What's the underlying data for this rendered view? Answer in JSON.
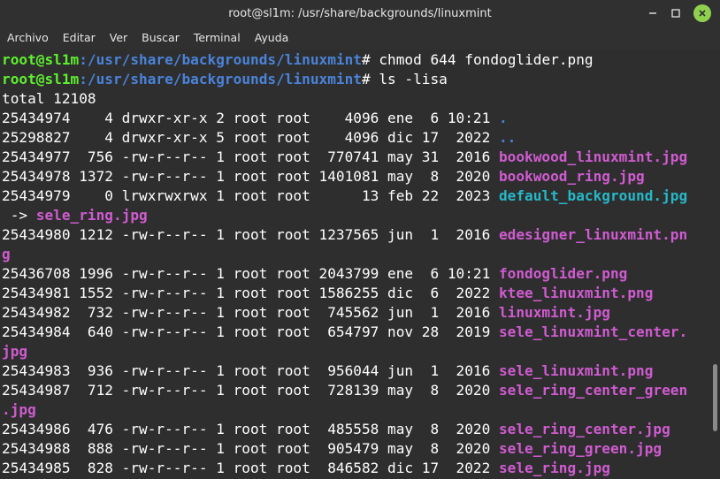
{
  "window": {
    "title": "root@sl1m: /usr/share/backgrounds/linuxmint",
    "buttons": {
      "minimize": "minimize-icon",
      "maximize": "maximize-icon",
      "close": "close-icon"
    },
    "close_color": "#8fd14f"
  },
  "menu": [
    "Archivo",
    "Editar",
    "Ver",
    "Buscar",
    "Terminal",
    "Ayuda"
  ],
  "terminal": {
    "prompt_user": "root@sl1m",
    "prompt_path": ":/usr/share/backgrounds/linuxmint",
    "prompt_symbol": "#",
    "commands": [
      " chmod 644 fondoglider.png",
      " ls -lisa"
    ],
    "total": "total 12108",
    "entries": [
      {
        "meta": "25434974    4 drwxr-xr-x 2 root root    4096 ene  6 10:21 ",
        "name": ".",
        "type": "dir"
      },
      {
        "meta": "25298827    4 drwxr-xr-x 5 root root    4096 dic 17  2022 ",
        "name": "..",
        "type": "dir"
      },
      {
        "meta": "25434977  756 -rw-r--r-- 1 root root  770741 may 31  2016 ",
        "name": "bookwood_linuxmint.jpg",
        "type": "img"
      },
      {
        "meta": "25434978 1372 -rw-r--r-- 1 root root 1401081 may  8  2020 ",
        "name": "bookwood_ring.jpg",
        "type": "img"
      },
      {
        "meta": "25434979    0 lrwxrwxrwx 1 root root      13 feb 22  2023 ",
        "name": "default_background.jpg",
        "type": "link",
        "wrap_prefix": " -> ",
        "wrap": "sele_ring.jpg"
      },
      {
        "meta": "25434980 1212 -rw-r--r-- 1 root root 1237565 jun  1  2016 ",
        "name": "edesigner_linuxmint.pn",
        "type": "img",
        "wrap": "g"
      },
      {
        "meta": "25436708 1996 -rw-r--r-- 1 root root 2043799 ene  6 10:21 ",
        "name": "fondoglider.png",
        "type": "img"
      },
      {
        "meta": "25434981 1552 -rw-r--r-- 1 root root 1586255 dic  6  2022 ",
        "name": "ktee_linuxmint.png",
        "type": "img"
      },
      {
        "meta": "25434982  732 -rw-r--r-- 1 root root  745562 jun  1  2016 ",
        "name": "linuxmint.jpg",
        "type": "img"
      },
      {
        "meta": "25434984  640 -rw-r--r-- 1 root root  654797 nov 28  2019 ",
        "name": "sele_linuxmint_center.",
        "type": "img",
        "wrap": "jpg"
      },
      {
        "meta": "25434983  936 -rw-r--r-- 1 root root  956044 jun  1  2016 ",
        "name": "sele_linuxmint.png",
        "type": "img"
      },
      {
        "meta": "25434987  712 -rw-r--r-- 1 root root  728139 may  8  2020 ",
        "name": "sele_ring_center_green",
        "type": "img",
        "wrap": ".jpg"
      },
      {
        "meta": "25434986  476 -rw-r--r-- 1 root root  485558 may  8  2020 ",
        "name": "sele_ring_center.jpg",
        "type": "img"
      },
      {
        "meta": "25434988  888 -rw-r--r-- 1 root root  905479 may  8  2020 ",
        "name": "sele_ring_green.jpg",
        "type": "img"
      },
      {
        "meta": "25434985  828 -rw-r--r-- 1 root root  846582 dic 17  2022 ",
        "name": "sele_ring.jpg",
        "type": "img"
      }
    ]
  },
  "colors": {
    "background": "#2e2e2e",
    "user": "#5ef02f",
    "path": "#4a83d9",
    "image": "#d05bd1",
    "link": "#26b8c8"
  }
}
